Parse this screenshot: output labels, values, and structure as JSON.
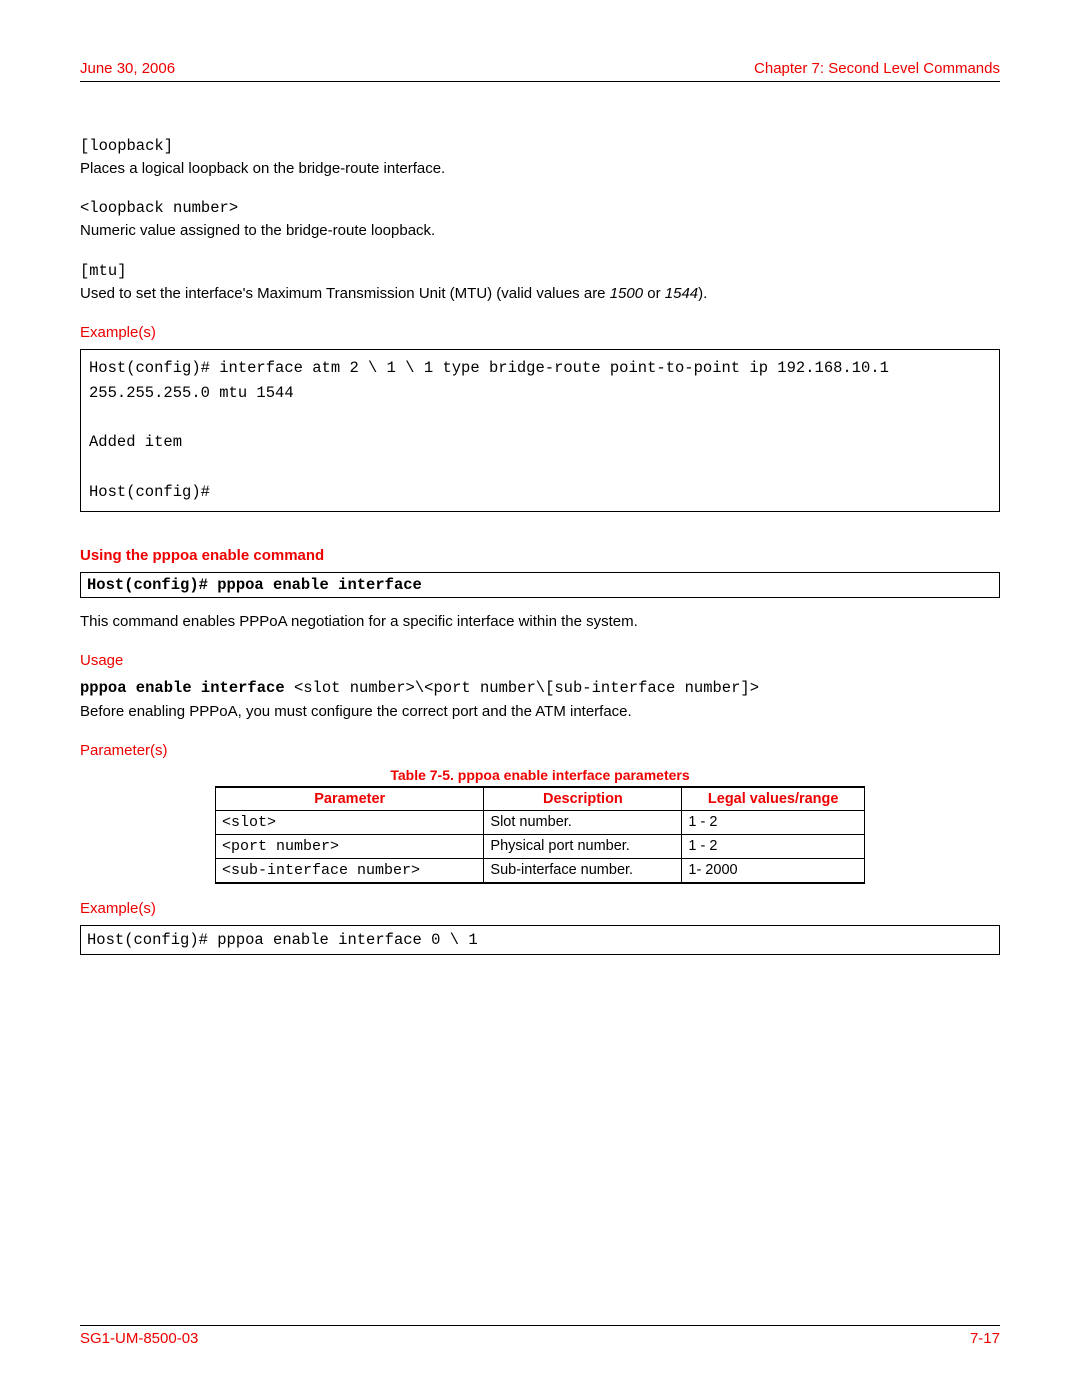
{
  "header": {
    "date": "June 30, 2006",
    "chapter": "Chapter 7: Second Level Commands"
  },
  "loopback": {
    "term": "[loopback]",
    "desc": "Places a logical loopback on the bridge-route interface."
  },
  "loopback_num": {
    "term": "<loopback number>",
    "desc": "Numeric value assigned to the bridge-route loopback."
  },
  "mtu": {
    "term": "[mtu]",
    "desc_prefix": "Used to set the interface's Maximum Transmission Unit (MTU) (valid values are ",
    "val1": "1500",
    "or": " or ",
    "val2": "1544",
    "desc_suffix": ")."
  },
  "examples1_heading": "Example(s)",
  "example1_code": "Host(config)# interface atm 2 \\ 1 \\ 1 type bridge-route point-to-point ip 192.168.10.1 255.255.255.0 mtu 1544\n\nAdded item\n\nHost(config)#",
  "pppoa_heading": "Using the pppoa enable command",
  "pppoa_cmd": "Host(config)# pppoa enable interface",
  "pppoa_desc": "This command enables PPPoA negotiation for a specific interface within the system.",
  "usage_heading": "Usage",
  "usage_bold": "pppoa enable interface ",
  "usage_mono": "<slot number>\\<port number\\[sub-interface number]>",
  "usage_note": "Before enabling PPPoA, you must configure the correct port and the ATM interface.",
  "params_heading": "Parameter(s)",
  "table_caption": "Table 7-5. pppoa enable interface parameters",
  "table": {
    "headers": [
      "Parameter",
      "Description",
      "Legal values/range"
    ],
    "rows": [
      {
        "param": "<slot>",
        "desc": "Slot number.",
        "range": "1 - 2"
      },
      {
        "param": "<port number>",
        "desc": "Physical port number.",
        "range": "1 - 2"
      },
      {
        "param": "<sub-interface number>",
        "desc": "Sub-interface number.",
        "range": "1- 2000"
      }
    ]
  },
  "examples2_heading": "Example(s)",
  "example2_code": "Host(config)# pppoa enable interface 0 \\ 1",
  "footer": {
    "docnum": "SG1-UM-8500-03",
    "pagenum": "7-17"
  }
}
